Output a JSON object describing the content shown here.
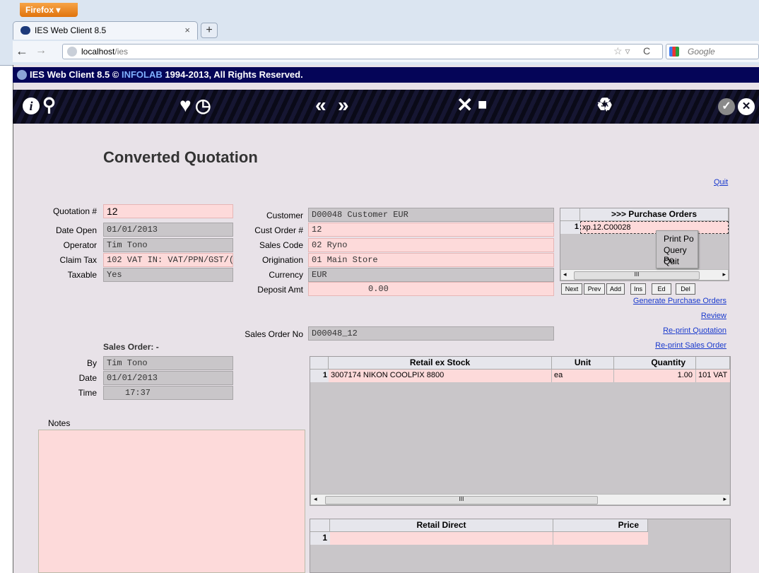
{
  "browser": {
    "menu_button": "Firefox ▾",
    "tab_title": "IES Web Client 8.5",
    "tab_close": "×",
    "new_tab": "+",
    "url_host": "localhost",
    "url_path": "/ies",
    "search_placeholder": "Google",
    "star": "☆ ▿",
    "reload": "C"
  },
  "banner": {
    "text_prefix": "IES Web Client 8.5 © ",
    "company": "INFOLAB",
    "text_suffix": " 1994-2013, All Rights Reserved."
  },
  "toolbar": {
    "info": "i",
    "search": "⚲",
    "favorite": "♥",
    "history": "◷",
    "prev": "«",
    "next": "»",
    "tools": "✕",
    "copy": "■",
    "recycle": "♻",
    "ok": "✓",
    "close": "✕"
  },
  "title": "Converted Quotation",
  "quit_link": "Quit",
  "left_fields": [
    {
      "label": "Quotation #",
      "value": "12"
    },
    {
      "label": "Date Open",
      "value": "01/01/2013"
    },
    {
      "label": "Operator",
      "value": "Tim Tono"
    },
    {
      "label": "Claim Tax",
      "value": "102 VAT IN: VAT/PPN/GST/("
    },
    {
      "label": "Taxable",
      "value": "Yes"
    }
  ],
  "mid_fields": [
    {
      "label": "Customer",
      "value": "D00048 Customer EUR"
    },
    {
      "label": "Cust Order #",
      "value": "12"
    },
    {
      "label": "Sales Code",
      "value": "02 Ryno"
    },
    {
      "label": "Origination",
      "value": "01 Main Store"
    },
    {
      "label": "Currency",
      "value": "EUR"
    },
    {
      "label": "Deposit Amt",
      "value": "0.00"
    }
  ],
  "sales_order_no": {
    "label": "Sales Order No",
    "value": "D00048_12"
  },
  "sales_order": {
    "heading": "Sales Order: -",
    "fields": [
      {
        "label": "By",
        "value": "Tim Tono"
      },
      {
        "label": "Date",
        "value": "01/01/2013"
      },
      {
        "label": "Time",
        "value": "17:37"
      }
    ]
  },
  "notes_label": "Notes",
  "po_grid": {
    "header": ">>> Purchase Orders",
    "row_num": "1",
    "row_value": "xp.12.C00028",
    "scroll_thumb": "III",
    "buttons": [
      "Next",
      "Prev",
      "Add",
      "Ins",
      "Ed",
      "Del"
    ]
  },
  "context_menu": [
    "Print Po",
    "Query Po",
    "Quit"
  ],
  "links": [
    "Generate Purchase Orders",
    "Review",
    "Re-print Quotation",
    "Re-print Sales Order"
  ],
  "stock_grid": {
    "headers": [
      "Retail ex Stock",
      "Unit",
      "Quantity"
    ],
    "row": {
      "num": "1",
      "item": "3007174 NIKON COOLPIX 8800",
      "unit": "ea",
      "quantity": "1.00",
      "extra": "101 VAT"
    },
    "scroll_thumb": "III"
  },
  "direct_grid": {
    "headers": [
      "Retail Direct",
      "Price"
    ],
    "row_num": "1"
  }
}
